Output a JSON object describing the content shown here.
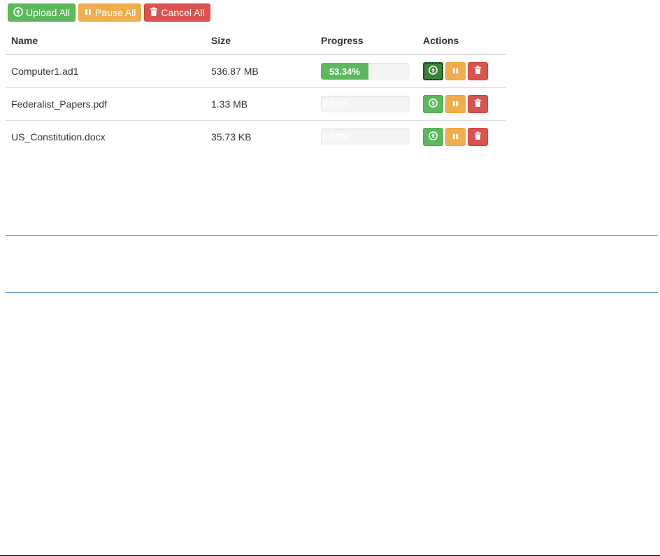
{
  "toolbar": {
    "upload_all": "Upload All",
    "pause_all": "Pause All",
    "cancel_all": "Cancel All"
  },
  "table": {
    "headers": {
      "name": "Name",
      "size": "Size",
      "progress": "Progress",
      "actions": "Actions"
    },
    "rows": [
      {
        "name": "Computer1.ad1",
        "size": "536.87 MB",
        "progress_label": "53.34%",
        "progress_value": 0.5334
      },
      {
        "name": "Federalist_Papers.pdf",
        "size": "1.33 MB",
        "progress_label": "0.00%",
        "progress_value": 0
      },
      {
        "name": "US_Constitution.docx",
        "size": "35.73 KB",
        "progress_label": "0.00%",
        "progress_value": 0
      }
    ]
  },
  "icons": {
    "upload": "circle-arrow-up-icon",
    "pause": "pause-icon",
    "cancel": "trash-icon"
  },
  "colors": {
    "success": "#5cb85c",
    "warning": "#f0ad4e",
    "danger": "#d9534f",
    "divider": "#4a87c4"
  }
}
